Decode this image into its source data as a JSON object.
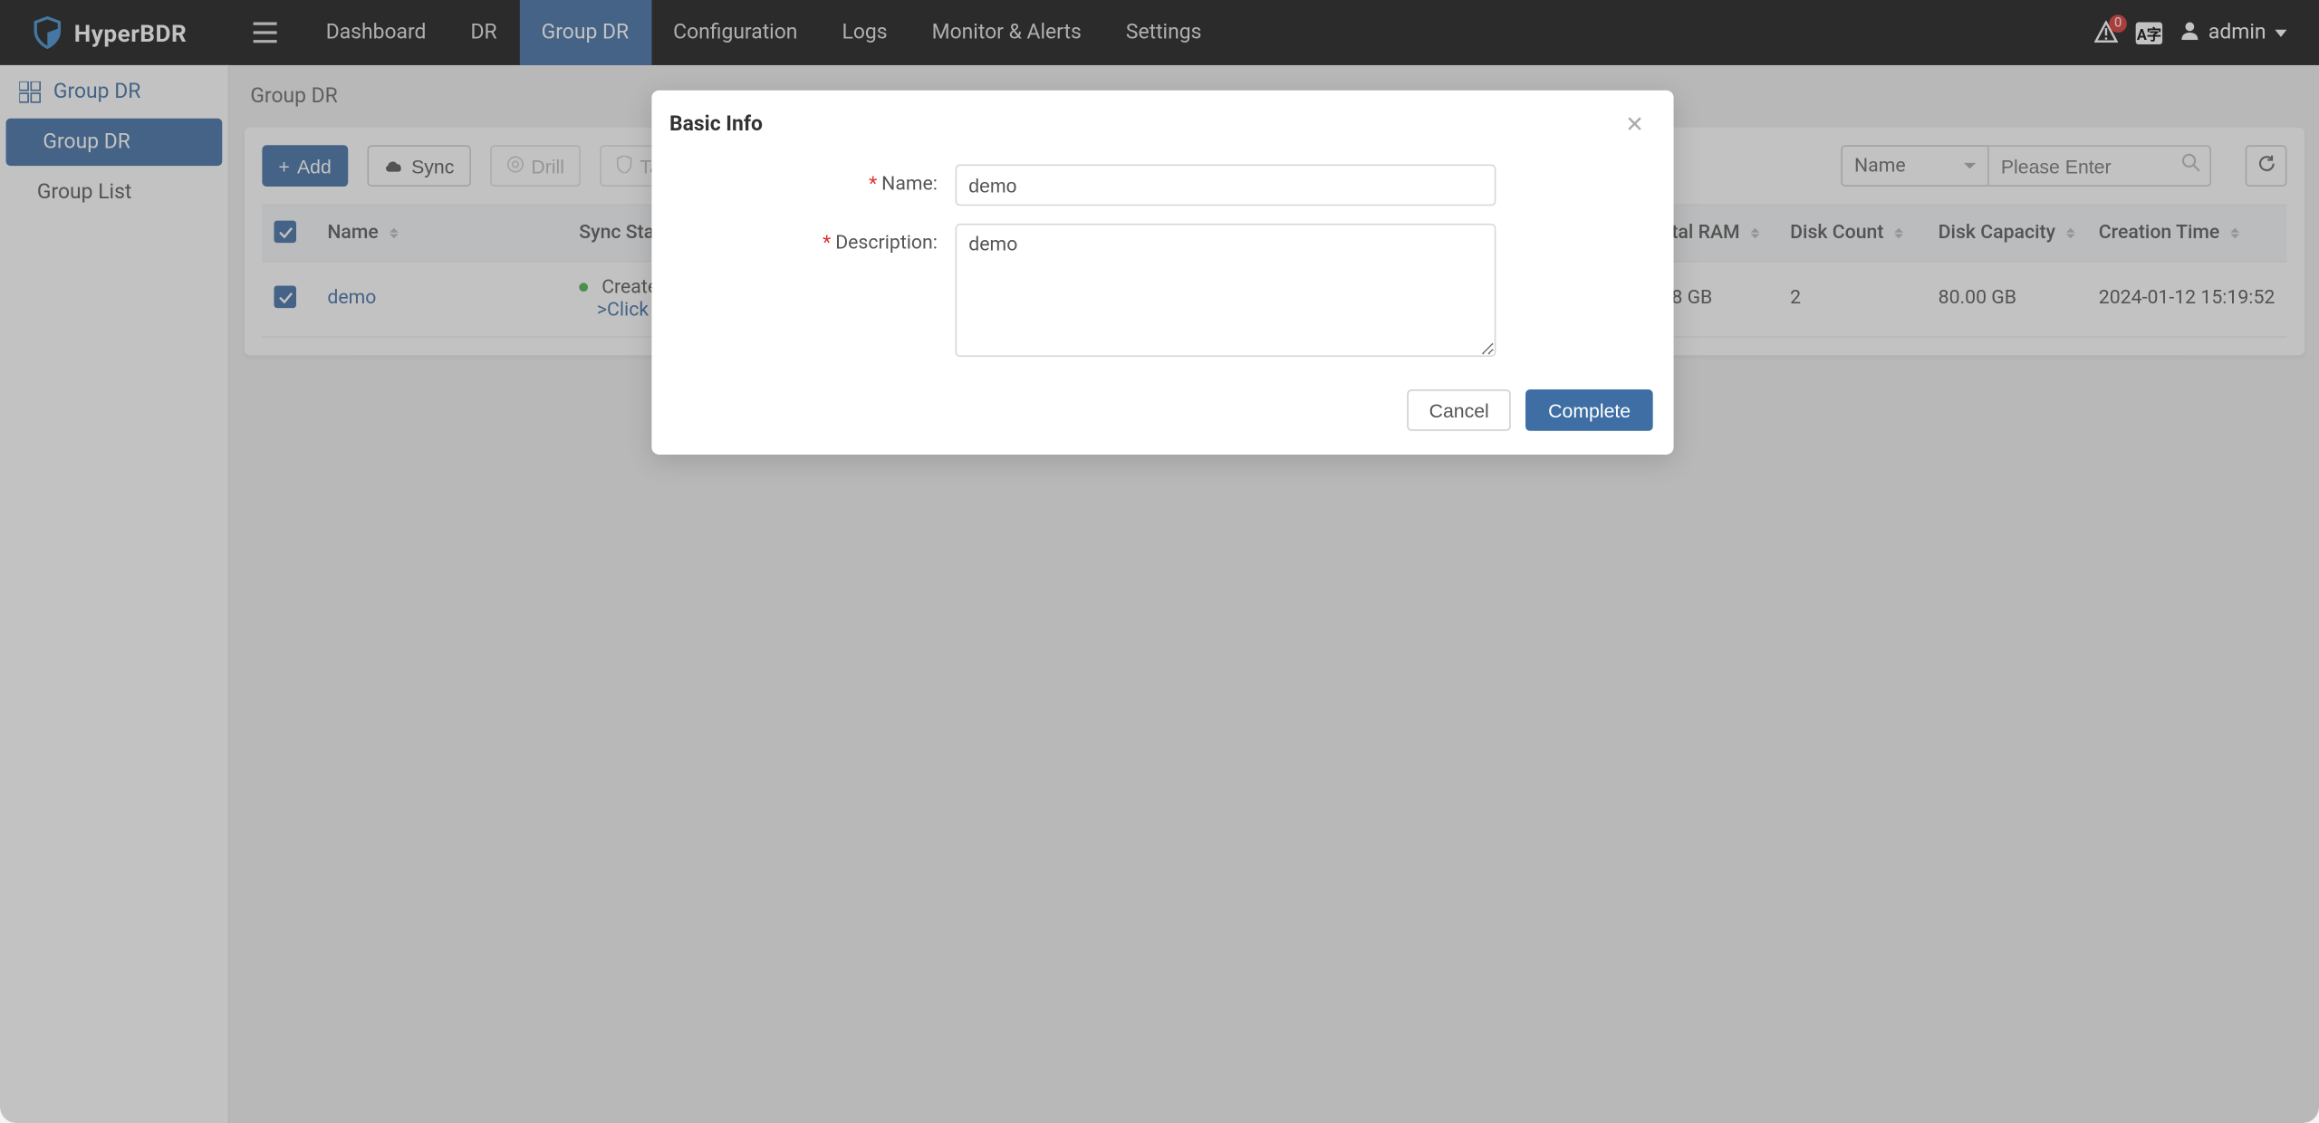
{
  "header": {
    "brand": "HyperBDR",
    "nav": [
      {
        "label": "Dashboard",
        "active": false
      },
      {
        "label": "DR",
        "active": false
      },
      {
        "label": "Group DR",
        "active": true
      },
      {
        "label": "Configuration",
        "active": false
      },
      {
        "label": "Logs",
        "active": false
      },
      {
        "label": "Monitor & Alerts",
        "active": false
      },
      {
        "label": "Settings",
        "active": false
      }
    ],
    "alert_count": "0",
    "lang": "A字",
    "user": "admin"
  },
  "sidebar": {
    "title": "Group DR",
    "items": [
      {
        "label": "Group DR",
        "active": true
      },
      {
        "label": "Group List",
        "active": false
      }
    ]
  },
  "breadcrumb": "Group DR",
  "toolbar": {
    "add": "Add",
    "sync": "Sync",
    "drill": "Drill",
    "takeover": "Takeover",
    "filter_field": "Name",
    "filter_placeholder": "Please Enter"
  },
  "table": {
    "cols": {
      "name": "Name",
      "sync_status": "Sync Status",
      "total_ram": "tal RAM",
      "disk_count": "Disk Count",
      "disk_capacity": "Disk Capacity",
      "creation_time": "Creation Time"
    },
    "rows": [
      {
        "name": "demo",
        "status_line1": "Created",
        "status_line2": ">Click fo",
        "total_ram": "8 GB",
        "disk_count": "2",
        "disk_capacity": "80.00 GB",
        "creation_time": "2024-01-12 15:19:52"
      }
    ]
  },
  "modal": {
    "title": "Basic Info",
    "name_label": "Name:",
    "name_value": "demo",
    "desc_label": "Description:",
    "desc_value": "demo",
    "cancel": "Cancel",
    "complete": "Complete"
  }
}
